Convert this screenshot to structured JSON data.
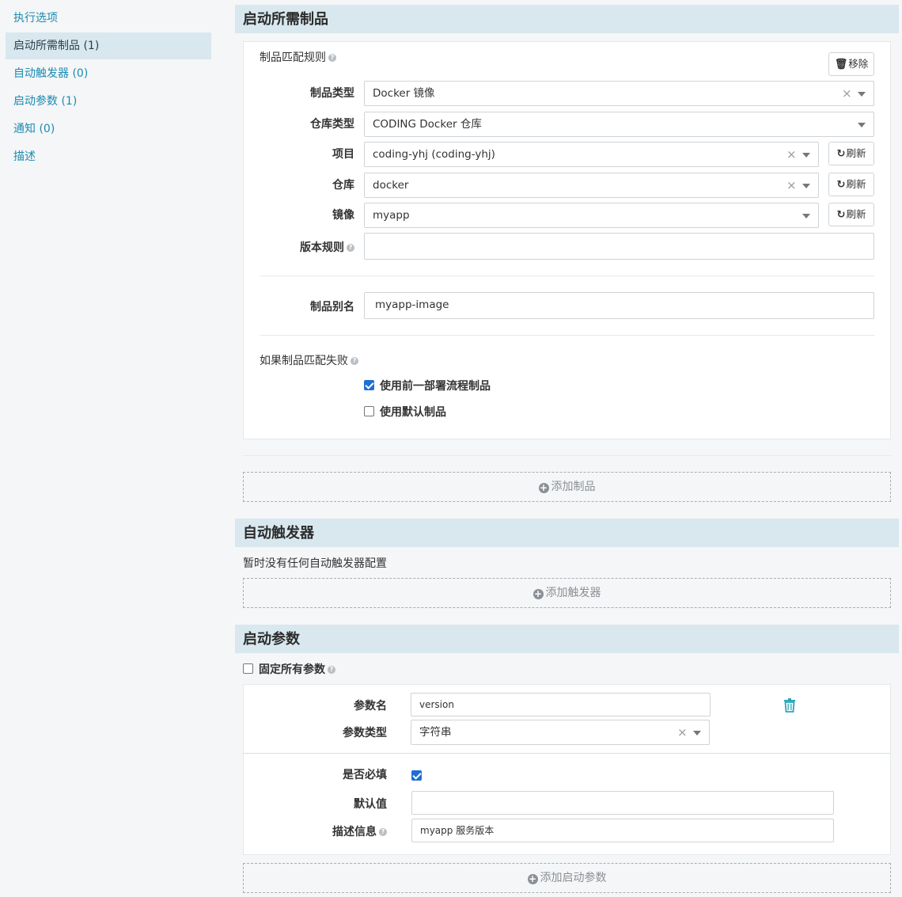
{
  "sidebar": {
    "items": [
      {
        "label": "执行选项"
      },
      {
        "label": "启动所需制品 (1)"
      },
      {
        "label": "自动触发器 (0)"
      },
      {
        "label": "启动参数 (1)"
      },
      {
        "label": "通知 (0)"
      },
      {
        "label": "描述"
      }
    ]
  },
  "artifacts": {
    "title": "启动所需制品",
    "match_rule_label": "制品匹配规则",
    "remove_label": "移除",
    "artifact_type": {
      "label": "制品类型",
      "value": "Docker 镜像"
    },
    "repo_type": {
      "label": "仓库类型",
      "value": "CODING Docker 仓库"
    },
    "project": {
      "label": "项目",
      "value": "coding-yhj (coding-yhj)"
    },
    "repository": {
      "label": "仓库",
      "value": "docker"
    },
    "image": {
      "label": "镜像",
      "value": "myapp"
    },
    "version_rule": {
      "label": "版本规则",
      "value": ""
    },
    "refresh_label": "刷新",
    "alias": {
      "label": "制品别名",
      "value": "myapp-image"
    },
    "fail_label": "如果制品匹配失败",
    "use_previous": {
      "label": "使用前一部署流程制品",
      "checked": true
    },
    "use_default": {
      "label": "使用默认制品",
      "checked": false
    },
    "add_label": "添加制品"
  },
  "triggers": {
    "title": "自动触发器",
    "empty_text": "暂时没有任何自动触发器配置",
    "add_label": "添加触发器"
  },
  "params": {
    "title": "启动参数",
    "fix_all_label": "固定所有参数",
    "name": {
      "label": "参数名",
      "value": "version"
    },
    "type": {
      "label": "参数类型",
      "value": "字符串"
    },
    "required": {
      "label": "是否必填",
      "checked": true
    },
    "default": {
      "label": "默认值",
      "value": ""
    },
    "description": {
      "label": "描述信息",
      "value": "myapp 服务版本"
    },
    "add_label": "添加启动参数"
  },
  "colors": {
    "link": "#1b8bb3",
    "header_bg": "#d8e8ee",
    "accent_check": "#1f6ed4",
    "trash": "#2aa6b8"
  }
}
